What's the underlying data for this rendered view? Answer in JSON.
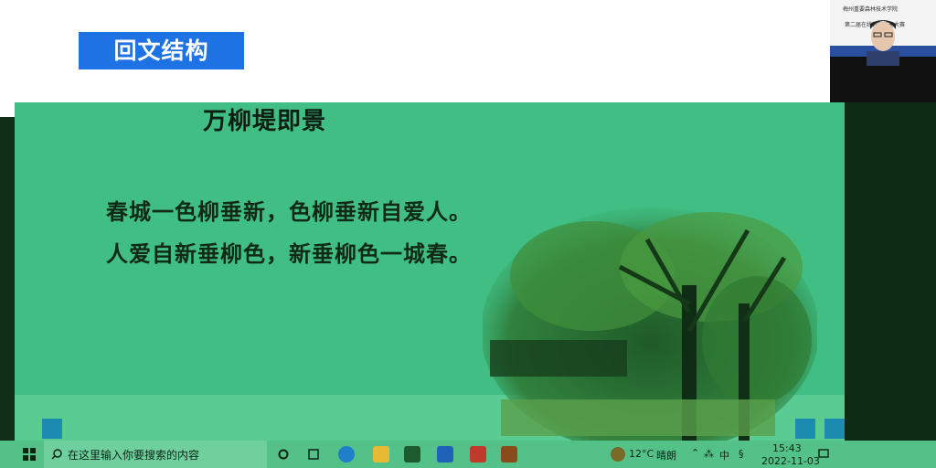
{
  "slide": {
    "heading": "回文结构",
    "title": "万柳堤即景",
    "poem": [
      "春城一色柳垂新，色柳垂新自爱人。",
      "人爱自新垂柳色，新垂柳色一城春。"
    ]
  },
  "webcam": {
    "institution": "梅州重要森林技术学院",
    "event": "第二届在线教学技能大赛"
  },
  "taskbar": {
    "search_placeholder": "在这里输入你要搜索的内容",
    "weather_temp": "12°C",
    "weather_desc": "晴朗",
    "ime_label": "中",
    "time": "15:43",
    "date": "2022-11-03",
    "icons": [
      "windows-start-icon",
      "search-icon",
      "task-view-icon",
      "widgets-icon",
      "edge-icon",
      "file-explorer-icon",
      "store-icon",
      "photos-icon",
      "wps-icon",
      "video-player-icon"
    ]
  },
  "colors": {
    "slide_green": "#40be83",
    "heading_blue": "#1f72e4",
    "taskbar_green": "#54c288"
  }
}
